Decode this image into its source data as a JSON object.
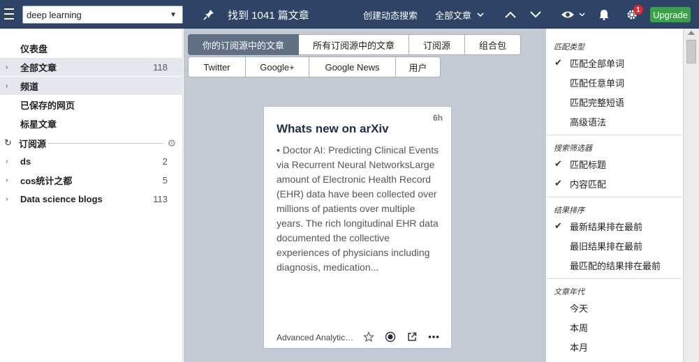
{
  "topbar": {
    "search_value": "deep learning",
    "found_text": "找到 1041 篇文章",
    "create_alert": "创建动态搜索",
    "all_articles": "全部文章",
    "notification_badge": "1",
    "upgrade": "Upgrade",
    "icons": [
      "menu-icon",
      "pin-icon",
      "chevron-down-icon",
      "arrow-up-icon",
      "arrow-down-icon",
      "eye-icon",
      "bell-icon",
      "gear-icon"
    ]
  },
  "sidebar": {
    "items": [
      {
        "label": "仪表盘",
        "count": ""
      },
      {
        "label": "全部文章",
        "count": "118"
      },
      {
        "label": "频道",
        "count": ""
      },
      {
        "label": "已保存的网页",
        "count": ""
      },
      {
        "label": "标星文章",
        "count": ""
      }
    ],
    "feeds_header": "订阅源",
    "feeds": [
      {
        "label": "ds",
        "count": "2"
      },
      {
        "label": "cos统计之都",
        "count": "5"
      },
      {
        "label": "Data science blogs",
        "count": "113"
      }
    ]
  },
  "main": {
    "tabs_row1": [
      "你的订阅源中的文章",
      "所有订阅源中的文章",
      "订阅源",
      "组合包"
    ],
    "tabs_row2": [
      "Twitter",
      "Google+",
      "Google News",
      "用户"
    ],
    "card": {
      "age": "6h",
      "title": "Whats new on arXiv",
      "body": "• Doctor AI: Predicting Clinical Events via Recurrent Neural NetworksLarge amount of Electronic Health Record (EHR) data have been collected over millions of patients over multiple years. The rich longitudinal EHR data documented the collective experiences of physicians including diagnosis, medication...",
      "source": "Advanced Analytics & R"
    }
  },
  "panel": {
    "sections": [
      {
        "header": "匹配类型",
        "items": [
          {
            "label": "匹配全部单词",
            "checked": true
          },
          {
            "label": "匹配任意单词",
            "checked": false
          },
          {
            "label": "匹配完整短语",
            "checked": false
          },
          {
            "label": "高级语法",
            "checked": false
          }
        ]
      },
      {
        "header": "搜索筛选器",
        "items": [
          {
            "label": "匹配标题",
            "checked": true
          },
          {
            "label": "内容匹配",
            "checked": true
          }
        ]
      },
      {
        "header": "结果排序",
        "items": [
          {
            "label": "最新结果排在最前",
            "checked": true
          },
          {
            "label": "最旧结果排在最前",
            "checked": false
          },
          {
            "label": "最匹配的结果排在最前",
            "checked": false
          }
        ]
      },
      {
        "header": "文章年代",
        "items": [
          {
            "label": "今天",
            "checked": false
          },
          {
            "label": "本周",
            "checked": false
          },
          {
            "label": "本月",
            "checked": false
          }
        ]
      }
    ]
  },
  "colors": {
    "topbar": "#2d4466",
    "main_bg": "#c4cad3",
    "upgrade": "#3aa347",
    "badge": "#e4262a",
    "active_tab": "#5f6f84"
  }
}
